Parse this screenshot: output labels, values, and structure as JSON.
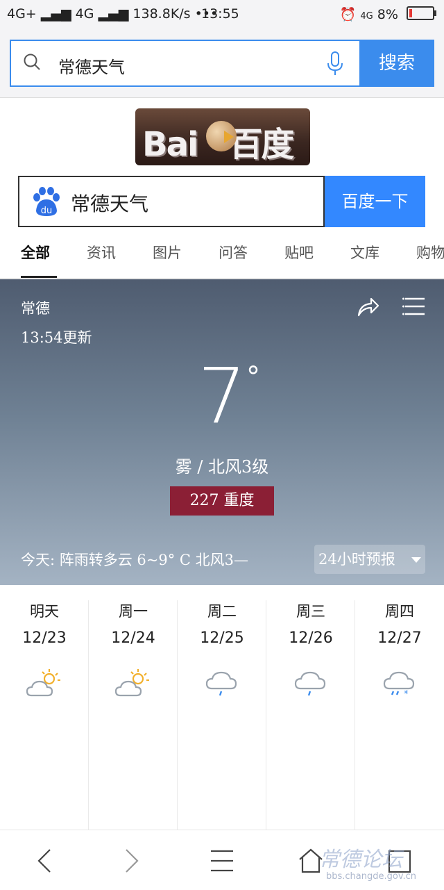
{
  "status": {
    "network1": "4G+",
    "network2": "4G",
    "speed": "138.8K/s",
    "dots": "•••",
    "time": "13:55",
    "network3": "4G",
    "battery": "8%"
  },
  "top_search": {
    "query": "常德天气",
    "button": "搜索"
  },
  "logo": {
    "text": "Bai 百度"
  },
  "baidu_search": {
    "query": "常德天气",
    "button": "百度一下"
  },
  "tabs": [
    "全部",
    "资讯",
    "图片",
    "问答",
    "贴吧",
    "文库",
    "购物"
  ],
  "weather": {
    "city": "常德",
    "updated": "13:54更新",
    "temp": "7",
    "deg": "°",
    "condition": "雾 / 北风3级",
    "aqi": "227 重度",
    "today": "今天: 阵雨转多云  6~9° C  北风3—",
    "forecast_button": "24小时预报"
  },
  "forecast": [
    {
      "day": "明天",
      "date": "12/23",
      "icon": "partly-cloudy-icon"
    },
    {
      "day": "周一",
      "date": "12/24",
      "icon": "partly-cloudy-icon"
    },
    {
      "day": "周二",
      "date": "12/25",
      "icon": "light-rain-icon"
    },
    {
      "day": "周三",
      "date": "12/26",
      "icon": "light-rain-icon"
    },
    {
      "day": "周四",
      "date": "12/27",
      "icon": "sleet-icon"
    }
  ],
  "watermark": {
    "text": "常德论坛",
    "url": "bbs.changde.gov.cn"
  },
  "colors": {
    "accent": "#3b8ced",
    "baidu_button": "#3388ff",
    "aqi_badge": "#8b1f35"
  }
}
